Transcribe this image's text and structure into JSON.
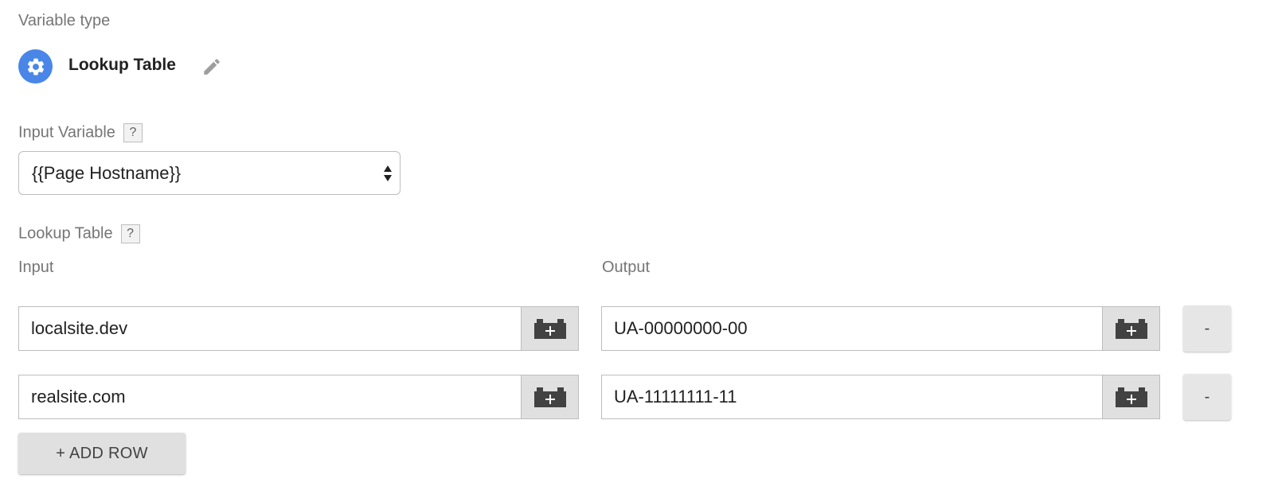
{
  "variable_type": {
    "label": "Variable type",
    "value": "Lookup Table",
    "icon": "gear-icon",
    "accent": "#4a86e8"
  },
  "input_variable": {
    "label": "Input Variable",
    "help": "?",
    "selected": "{{Page Hostname}}"
  },
  "lookup_table": {
    "label": "Lookup Table",
    "help": "?",
    "input_header": "Input",
    "output_header": "Output",
    "rows": [
      {
        "input": "localsite.dev",
        "output": "UA-00000000-00",
        "remove_label": "-"
      },
      {
        "input": "realsite.com",
        "output": "UA-11111111-11",
        "remove_label": "-"
      }
    ],
    "add_row_label": "+ ADD ROW"
  }
}
